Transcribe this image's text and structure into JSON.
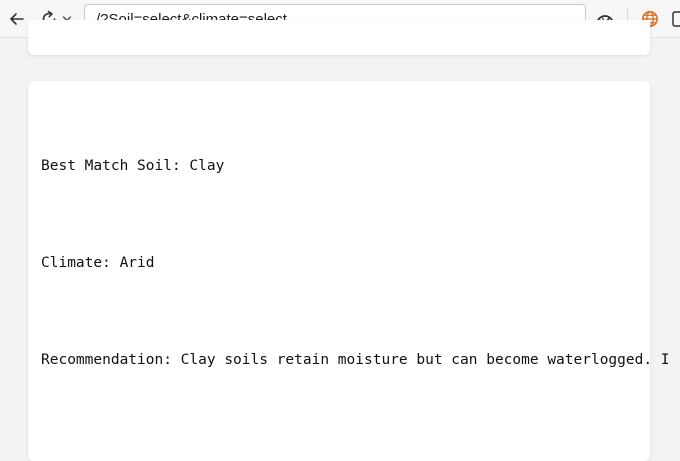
{
  "browser": {
    "address": "/?Soil=select&climate=select",
    "icons": {
      "back": "arrow-left-icon",
      "reload": "refresh-icon",
      "reload_menu": "chevron-down-icon",
      "performance": "speedometer-icon",
      "globe": "globe-icon",
      "extension": "sidebar-panel-icon"
    }
  },
  "result": {
    "soil_line": "Best Match Soil: Clay",
    "climate_line": "Climate: Arid",
    "recommendation_line": "Recommendation: Clay soils retain moisture but can become waterlogged. I"
  },
  "colors": {
    "page_background": "#f3f3f3",
    "card_background": "#ffffff",
    "globe_accent": "#e06a1b"
  }
}
